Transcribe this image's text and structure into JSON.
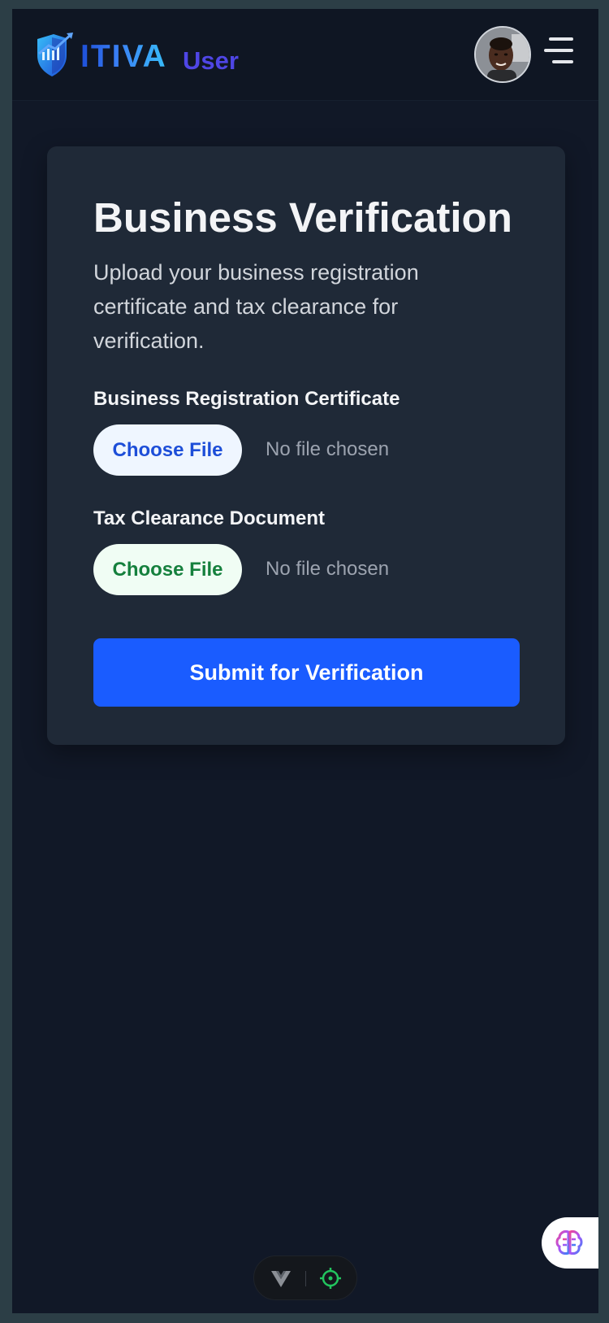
{
  "header": {
    "logo_text": "ITIVA",
    "logo_subtext": "User",
    "avatar_alt": "User avatar",
    "menu_icon": "hamburger-menu-icon"
  },
  "verification": {
    "title": "Business Verification",
    "description": "Upload your business registration certificate and tax clearance for verification.",
    "fields": [
      {
        "label": "Business Registration Certificate",
        "button_label": "Choose File",
        "status": "No file chosen"
      },
      {
        "label": "Tax Clearance Document",
        "button_label": "Choose File",
        "status": "No file chosen"
      }
    ],
    "submit_label": "Submit for Verification"
  },
  "floating": {
    "ai_assistant_icon": "brain-icon",
    "toolbar_icons": [
      "vue-logo-icon",
      "crosshair-icon"
    ]
  },
  "colors": {
    "page_bg": "#111827",
    "card_bg": "#1f2937",
    "primary": "#1a5cff",
    "blue_text": "#1d4ed8",
    "green_text": "#15803d"
  }
}
